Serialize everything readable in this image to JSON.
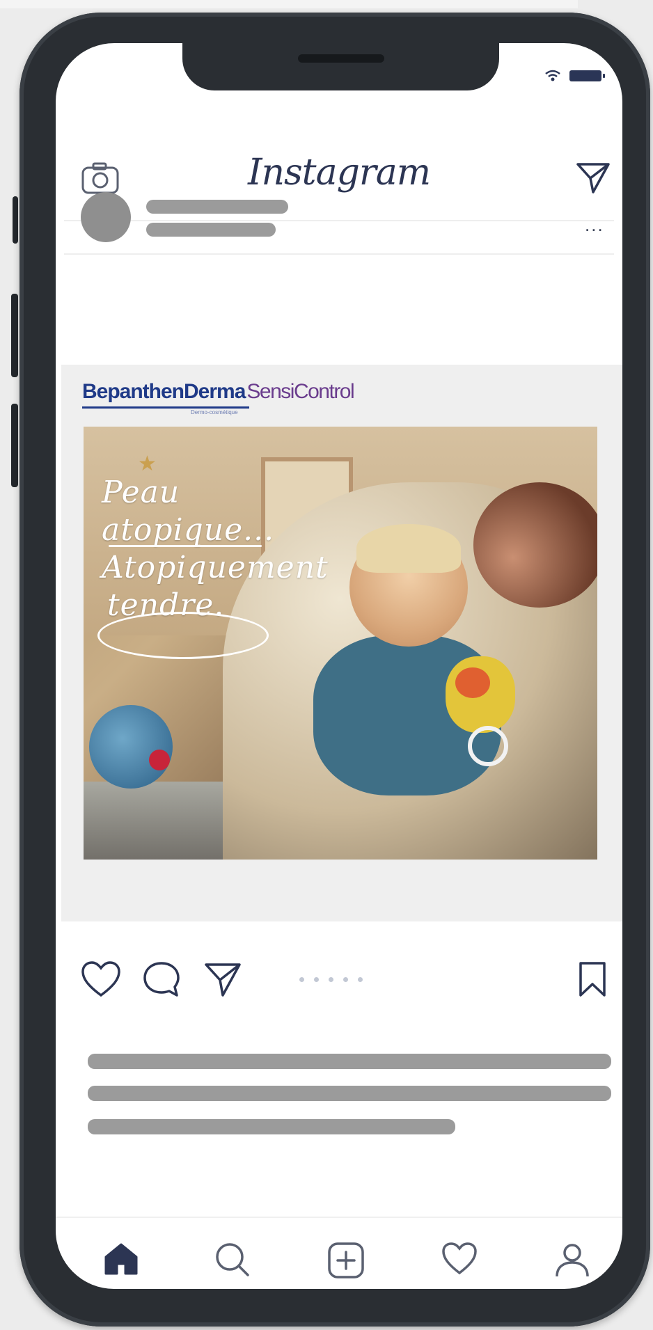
{
  "app": {
    "title": "Instagram"
  },
  "status_bar": {
    "wifi_icon": "wifi-icon",
    "battery_icon": "battery-icon"
  },
  "header": {
    "left_icon": "camera-icon",
    "right_icon": "direct-send-icon"
  },
  "post": {
    "avatar": "avatar",
    "more_label": "...",
    "ad": {
      "brand_main": "BepanthenDerma",
      "brand_sub": "SensiControl",
      "brand_tagline": "Dermo-cosmétique",
      "headline_lines": [
        "Peau",
        "atopique...",
        "Atopiquement",
        "tendre."
      ]
    }
  },
  "actions": {
    "icons": [
      "heart-icon",
      "comment-icon",
      "share-icon",
      "bookmark-icon"
    ],
    "carousel_dots": 5
  },
  "bottom_nav": {
    "items": [
      "home-icon",
      "search-icon",
      "add-post-icon",
      "activity-heart-icon",
      "profile-icon"
    ]
  },
  "colors": {
    "icon": "#2c3553",
    "skeleton": "#9b9b9b",
    "brand_blue": "#1f3a88",
    "brand_purple": "#6a3c8d"
  }
}
